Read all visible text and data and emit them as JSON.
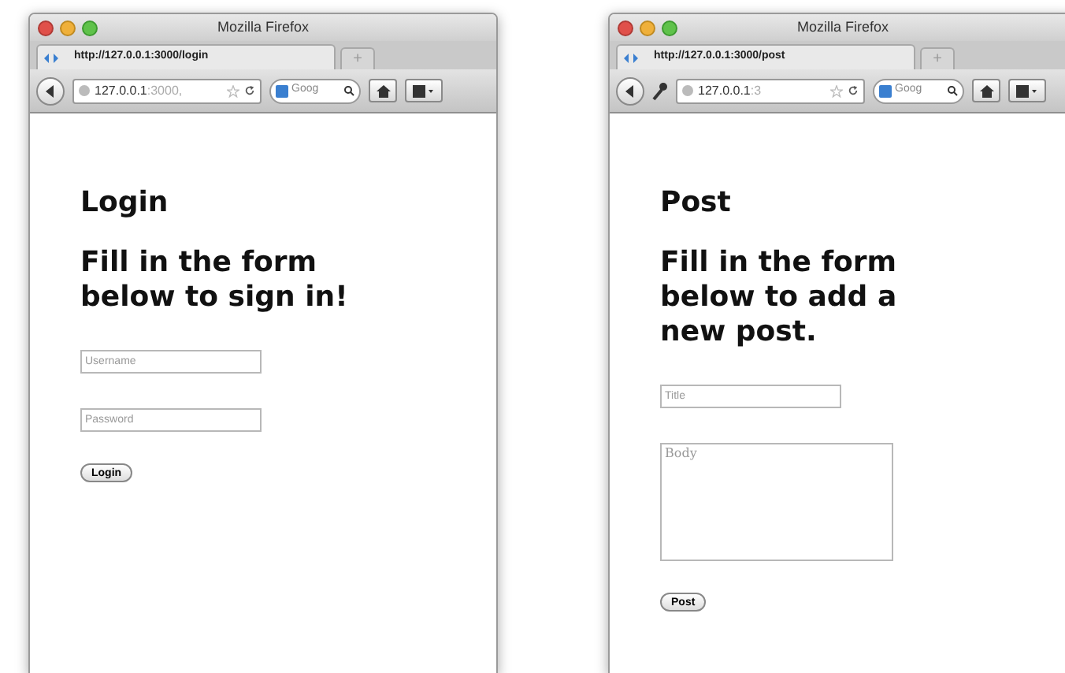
{
  "windows": [
    {
      "title": "Mozilla Firefox",
      "tab": {
        "url": "http://127.0.0.1:3000/login",
        "new_tab": "+"
      },
      "toolbar": {
        "key_icon": false,
        "url_host": "127.0.0.1",
        "url_rest": ":3000,",
        "search": "Goog"
      },
      "page": {
        "heading": "Login",
        "subheading": [
          "Fill in the form",
          "below to sign in!"
        ],
        "fields": [
          {
            "kind": "input",
            "placeholder": "Username"
          },
          {
            "kind": "input",
            "placeholder": "Password"
          }
        ],
        "button": "Login"
      }
    },
    {
      "title": "Mozilla Firefox",
      "tab": {
        "url": "http://127.0.0.1:3000/post",
        "new_tab": "+"
      },
      "toolbar": {
        "key_icon": true,
        "url_host": "127.0.0.1",
        "url_rest": ":3",
        "search": "Goog"
      },
      "page": {
        "heading": "Post",
        "subheading": [
          "Fill in the form",
          "below to add a",
          "new post."
        ],
        "fields": [
          {
            "kind": "input",
            "placeholder": "Title"
          },
          {
            "kind": "textarea",
            "placeholder": "Body"
          }
        ],
        "button": "Post"
      }
    }
  ]
}
